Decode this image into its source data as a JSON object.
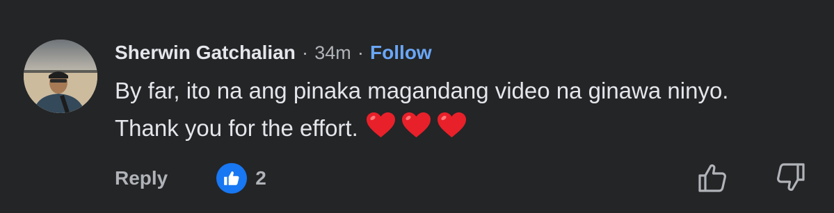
{
  "comment": {
    "author": "Sherwin Gatchalian",
    "separator": "·",
    "time": "34m",
    "follow_label": "Follow",
    "text_line1": "By far, ito na ang pinaka magandang video na ginawa ninyo.",
    "text_line2": "Thank you for the effort.",
    "emoji": [
      "heart",
      "heart",
      "heart"
    ]
  },
  "actions": {
    "reply_label": "Reply",
    "like_count": "2"
  },
  "colors": {
    "background": "#242526",
    "follow": "#6aa6f8",
    "like_badge": "#1877f2",
    "heart": "#e8202a"
  },
  "icons": [
    "avatar-photo",
    "like-badge-icon",
    "thumbs-up-outline-icon",
    "thumbs-down-outline-icon",
    "heart-emoji-icon"
  ]
}
